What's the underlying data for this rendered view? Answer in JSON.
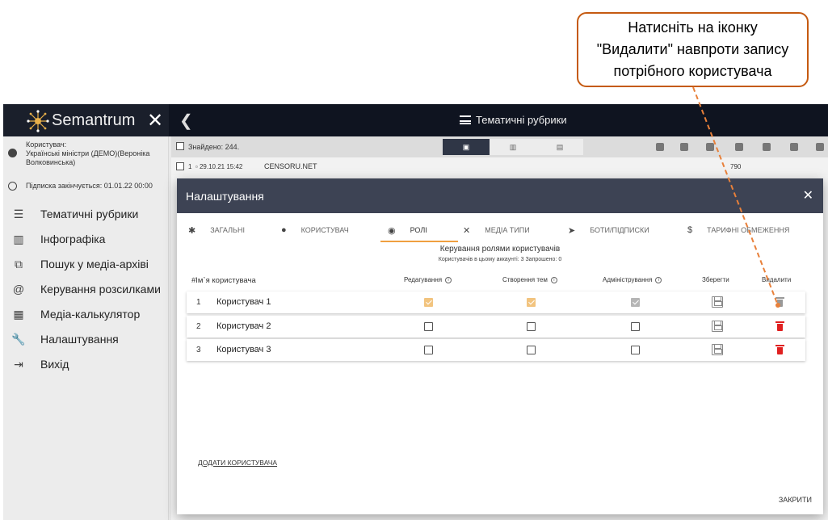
{
  "callout": {
    "line1": "Натисніть на іконку",
    "line2": "\"Видалити\" навпроти запису",
    "line3": "потрібного користувача",
    "border_color": "#c55a11"
  },
  "topbar": {
    "logo": "Semantrum",
    "page_title": "Тематичні рубрики"
  },
  "sidebar": {
    "user_label": "Користувач:",
    "user_name": "Українські міністри (ДЕМО)(Вероніка Волковинська)",
    "subscription": "Підписка закінчується: 01.01.22 00:00",
    "items": [
      {
        "label": "Тематичні рубрики",
        "icon": "list-icon"
      },
      {
        "label": "Інфографіка",
        "icon": "chart-icon"
      },
      {
        "label": "Пошук у медіа-архіві",
        "icon": "external-search-icon"
      },
      {
        "label": "Керування розсилками",
        "icon": "at-icon"
      },
      {
        "label": "Медіа-калькулятор",
        "icon": "calculator-icon"
      },
      {
        "label": "Налаштування",
        "icon": "wrench-icon"
      },
      {
        "label": "Вихід",
        "icon": "logout-icon"
      }
    ]
  },
  "list": {
    "found": "Знайдено: 244.",
    "row1_num": "1",
    "row1_date": "29.10.21 15:42",
    "row1_source": "CENSORU.NET",
    "row1_count": "790"
  },
  "modal": {
    "title": "Налаштування",
    "tabs": [
      {
        "label": "Загальні",
        "icon": "gear-icon"
      },
      {
        "label": "Користувач",
        "icon": "user-icon"
      },
      {
        "label": "Ролі",
        "icon": "role-icon"
      },
      {
        "label": "Медіа типи",
        "icon": "tools-icon"
      },
      {
        "label": "Боти/Підписки",
        "icon": "send-icon"
      },
      {
        "label": "Тарифні обмеження",
        "icon": "dollar-icon"
      }
    ],
    "active_tab": "Ролі",
    "section_title": "Керування ролями користувачів",
    "section_sub": "Користувачів в цьому аккаунті: 3  Запрошено: 0",
    "columns": {
      "name": "#Ім`я користувача",
      "edit": "Редагування",
      "create": "Створення тем",
      "admin": "Адміністрування",
      "save": "Зберегти",
      "delete": "Видалити"
    },
    "users": [
      {
        "index": "1",
        "name": "Користувач 1",
        "edit": true,
        "create": true,
        "admin": true,
        "disabled": true
      },
      {
        "index": "2",
        "name": "Користувач 2",
        "edit": false,
        "create": false,
        "admin": false,
        "disabled": false
      },
      {
        "index": "3",
        "name": "Користувач 3",
        "edit": false,
        "create": false,
        "admin": false,
        "disabled": false
      }
    ],
    "add_user": "Додати користувача",
    "close": "Закрити",
    "accent_color": "#f0a040",
    "delete_color": "#e02020"
  }
}
